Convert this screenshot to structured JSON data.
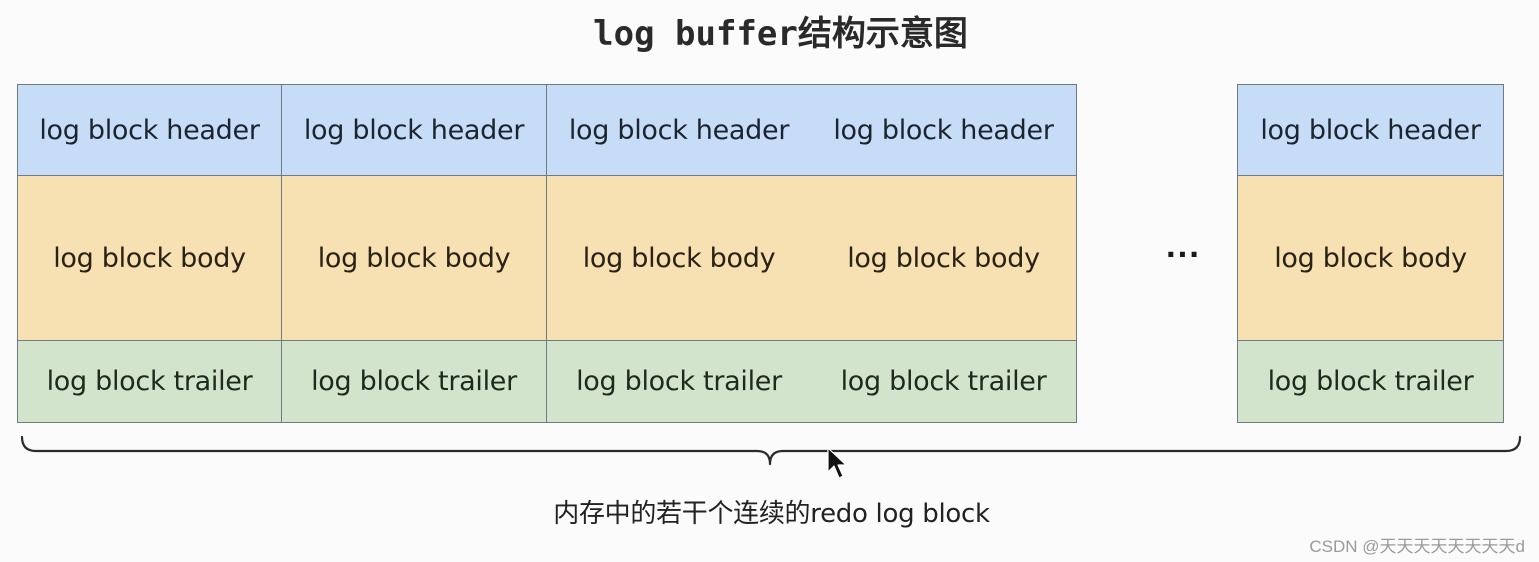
{
  "title": "log buffer结构示意图",
  "colors": {
    "header": "#c7dcf6",
    "body": "#f7e0b1",
    "trailer": "#d3e4cc",
    "border": "#6f7b83"
  },
  "blocks": [
    {
      "header": "log block header",
      "body": "log block body",
      "trailer": "log block trailer"
    },
    {
      "header": "log block header",
      "body": "log block body",
      "trailer": "log block trailer"
    },
    {
      "header": "log block header",
      "body": "log block body",
      "trailer": "log block trailer"
    },
    {
      "header": "log block header",
      "body": "log block body",
      "trailer": "log block trailer"
    },
    {
      "header": "log block header",
      "body": "log block body",
      "trailer": "log block trailer"
    }
  ],
  "ellipsis": "···",
  "caption": "内存中的若干个连续的redo log block",
  "watermark": "CSDN @天天天天天天天天d",
  "icons": {
    "brace": "curly-brace",
    "cursor": "mouse-pointer"
  }
}
